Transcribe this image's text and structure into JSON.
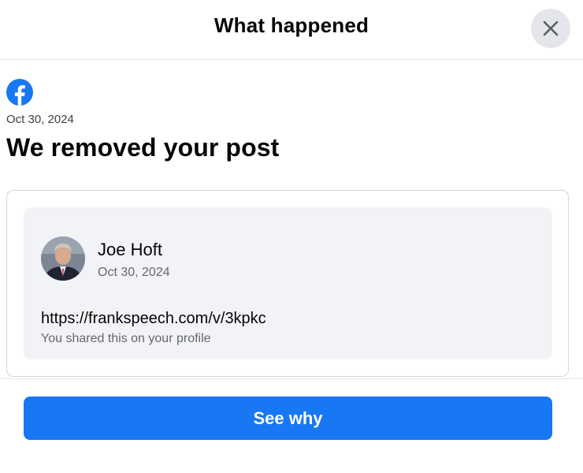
{
  "dialog": {
    "title": "What happened",
    "close_icon": "close-icon"
  },
  "notice": {
    "app_icon": "facebook-logo-icon",
    "date": "Oct 30, 2024",
    "headline": "We removed your post"
  },
  "post": {
    "author_name": "Joe Hoft",
    "author_date": "Oct 30, 2024",
    "link": "https://frankspeech.com/v/3kpkc",
    "note": "You shared this on your profile"
  },
  "actions": {
    "see_why_label": "See why"
  },
  "colors": {
    "brand_blue": "#1877f2",
    "close_button_bg": "#e4e6eb",
    "post_bg": "#f2f3f6",
    "secondary_text": "#65676b"
  }
}
